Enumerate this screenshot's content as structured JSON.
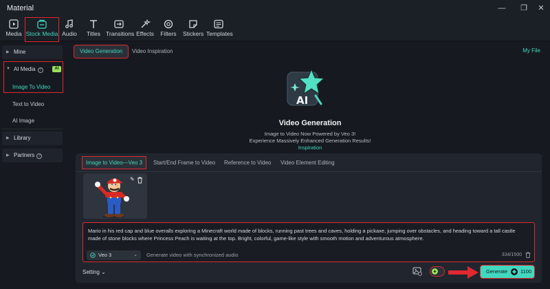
{
  "window": {
    "title": "Material"
  },
  "toolbar": {
    "items": [
      {
        "label": "Media",
        "icon": "media-icon"
      },
      {
        "label": "Stock Media",
        "icon": "stock-media-icon"
      },
      {
        "label": "Audio",
        "icon": "audio-icon"
      },
      {
        "label": "Titles",
        "icon": "titles-icon"
      },
      {
        "label": "Transitions",
        "icon": "transitions-icon"
      },
      {
        "label": "Effects",
        "icon": "effects-icon"
      },
      {
        "label": "Filters",
        "icon": "filters-icon"
      },
      {
        "label": "Stickers",
        "icon": "stickers-icon"
      },
      {
        "label": "Templates",
        "icon": "templates-icon"
      }
    ],
    "active": "Stock Media"
  },
  "sidebar": {
    "mine": "Mine",
    "ai_media": "AI Media",
    "ai_badge": "AI",
    "sub_items": [
      "Image To Video",
      "Text to Video",
      "AI Image"
    ],
    "library": "Library",
    "partners": "Partners"
  },
  "top_tabs": [
    "Video Generation",
    "Video Inspiration"
  ],
  "my_file": "My File",
  "hero": {
    "title": "Video Generation",
    "line1": "Image to Video Now Powered by Veo 3!",
    "line2": "Experience Massively Enhanced Generation Results!",
    "link": "Inspiration"
  },
  "panel_tabs": [
    "Image to Video—Veo 3",
    "Start/End Frame to Video",
    "Reference to Video",
    "Video Element Editing"
  ],
  "prompt": {
    "text": "Mario in his red cap and blue overalls exploring a Minecraft world made of blocks, running past trees and caves, holding a pickaxe, jumping over obstacles, and heading toward a tall castle made of stone blocks where Princess Peach is waiting at the top. Bright, colorful, game-like style with smooth motion and adventurous atmosphere.",
    "model": "Veo 3",
    "audio_label": "Generate video with synchronized audio",
    "counter": "334/1500"
  },
  "footer": {
    "setting": "Setting",
    "generate": "Generate",
    "credits": "1100"
  },
  "colors": {
    "accent": "#41d8bf",
    "highlight": "#e0292f",
    "badge": "#9be15d"
  }
}
